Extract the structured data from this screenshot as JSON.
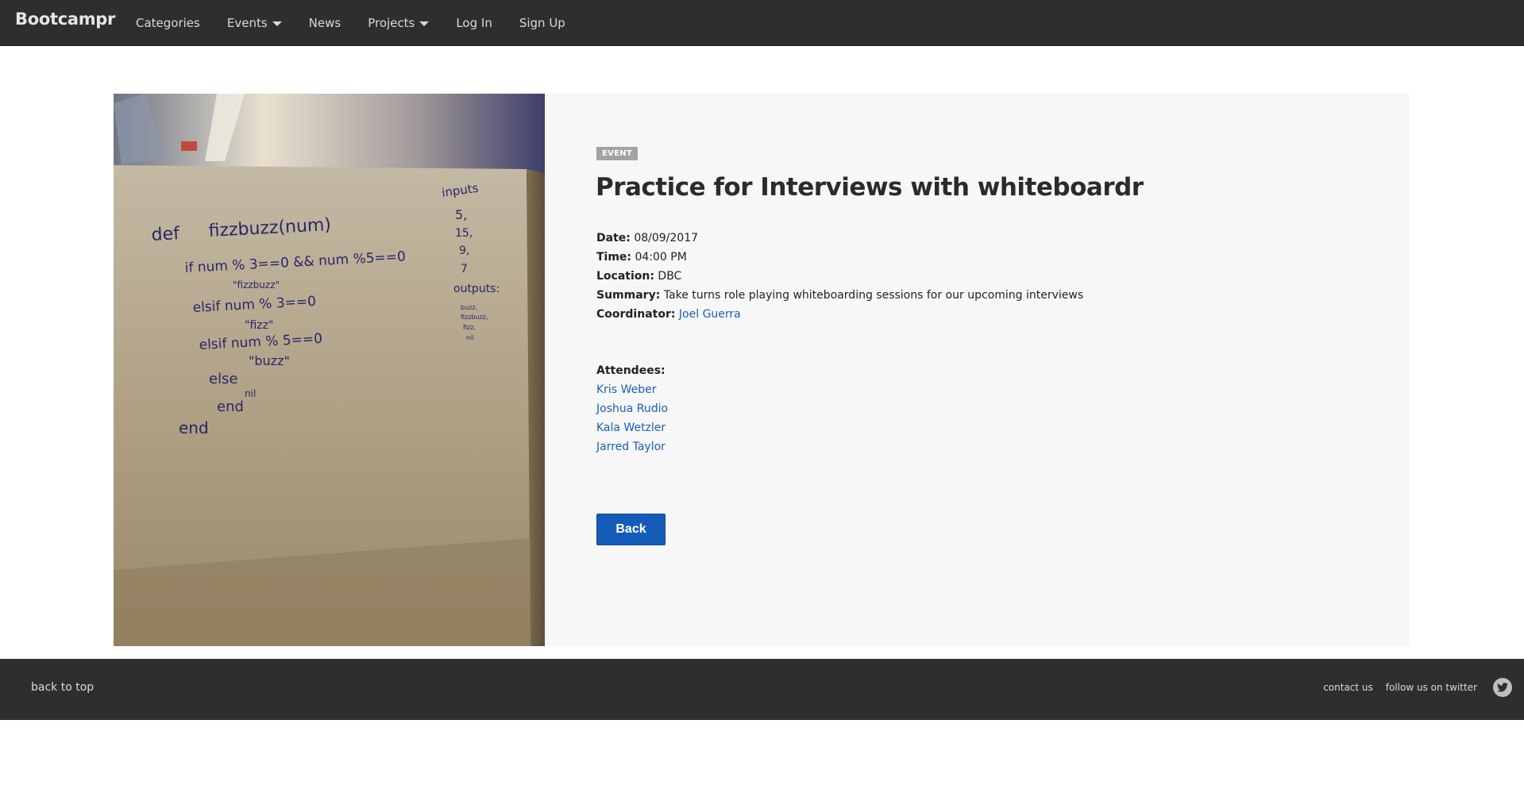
{
  "navbar": {
    "brand": "Bootcampr",
    "items": [
      {
        "label": "Categories"
      },
      {
        "label": "Events"
      },
      {
        "label": "News"
      },
      {
        "label": "Projects"
      },
      {
        "label": "Log In"
      },
      {
        "label": "Sign Up"
      }
    ]
  },
  "event": {
    "badge": "EVENT",
    "title": "Practice for Interviews with whiteboardr",
    "date_label": "Date:",
    "date": "08/09/2017",
    "time_label": "Time:",
    "time": "04:00 PM",
    "location_label": "Location:",
    "location": "DBC",
    "summary_label": "Summary:",
    "summary": "Take turns role playing whiteboarding sessions for our upcoming interviews",
    "coordinator_label": "Coordinator:",
    "coordinator": "Joel Guerra",
    "attendees_label": "Attendees:",
    "attendees": [
      "Kris Weber",
      "Joshua Rudio",
      "Kala Wetzler",
      "Jarred Taylor"
    ],
    "back_label": "Back"
  },
  "photo": {
    "whiteboard_code": [
      "def fizzbuzz(num)",
      "if num % 3==0 && num %5==0",
      "\"fizzbuzz\"",
      "elsif num % 3==0",
      "\"fizz\"",
      "elsif num % 5==0",
      "\"buzz\"",
      "else",
      "nil",
      "end",
      "end"
    ],
    "whiteboard_side": [
      "inputs",
      "5,",
      "15,",
      "9,",
      "7",
      "outputs:",
      "buzz,",
      "fizzbuzz,",
      "fizz,",
      "nil"
    ]
  },
  "footer": {
    "back_to_top": "back to top",
    "contact": "contact us",
    "twitter": "follow us on twitter"
  },
  "colors": {
    "navbar_bg": "#2e2e2e",
    "link": "#1b5fb4",
    "button": "#155cb8",
    "panel_bg": "#f7f7f7"
  }
}
